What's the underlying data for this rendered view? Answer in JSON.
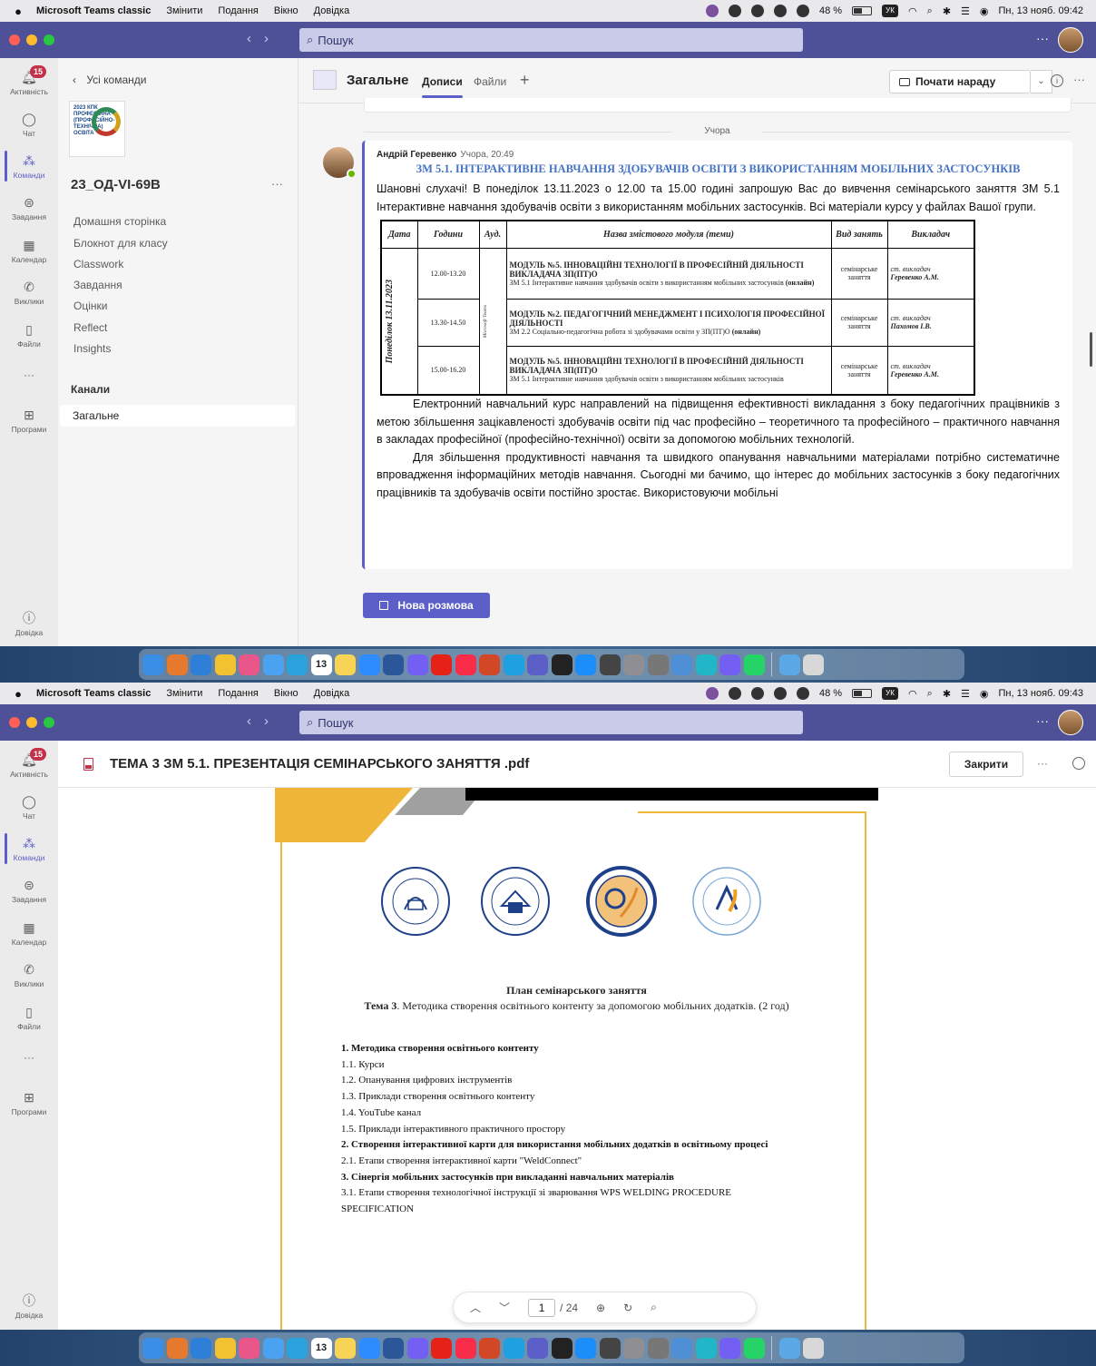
{
  "menubar": {
    "apple": "",
    "app": "Microsoft Teams classic",
    "items": [
      "Змінити",
      "Подання",
      "Вікно",
      "Довідка"
    ],
    "battery": "48 %",
    "keyboard": "УК",
    "datetime_1": "Пн, 13 нояб. 09:42",
    "datetime_2": "Пн, 13 нояб. 09:43"
  },
  "titlebar": {
    "search_placeholder": "Пошук",
    "more": "···"
  },
  "rail": {
    "activity": "Активність",
    "activity_badge": "15",
    "chat": "Чат",
    "teams": "Команди",
    "assignments": "Завдання",
    "calendar": "Календар",
    "calls": "Виклики",
    "files": "Файли",
    "more": "···",
    "apps": "Програми",
    "help": "Довідка"
  },
  "team": {
    "back": "Усі команди",
    "logo_text": "2023 КПК ПРОФЕСІЙНА (ПРОФЕСІЙНО-ТЕХНІЧНА) ОСВІТА",
    "name": "23_ОД-VI-69В",
    "menu": "···",
    "links": [
      "Домашня сторінка",
      "Блокнот для класу",
      "Classwork",
      "Завдання",
      "Оцінки",
      "Reflect",
      "Insights"
    ],
    "channels_header": "Канали",
    "channel": "Загальне"
  },
  "channel": {
    "name": "Загальне",
    "tabs": [
      "Дописи",
      "Файли"
    ],
    "plus": "+",
    "meet": "Почати нараду",
    "date_separator": "Учора",
    "new_conversation": "Нова розмова"
  },
  "post": {
    "author": "Андрій Геревенко",
    "time": "Учора, 20:49",
    "title": "ЗМ 5.1. ІНТЕРАКТИВНЕ НАВЧАННЯ ЗДОБУВАЧІВ ОСВІТИ З ВИКОРИСТАННЯМ МОБІЛЬНИХ ЗАСТОСУНКІВ",
    "greeting": "Шановні слухачі! В понеділок 13.11.2023 о 12.00 та 15.00 годині запрошую Вас до вивчення семінарського заняття ЗМ 5.1 Інтерактивне навчання здобувачів освіти з використанням мобільних застосунків. Всі матеріали курсу у файлах Вашої групи.",
    "para1": "Електронний навчальний курс направлений на підвищення ефективності викладання з боку педагогічних працівників з метою збільшення зацікавленості здобувачів освіти під час професійно – теоретичного та професійного – практичного навчання в закладах професійної (професійно-технічної) освіти за допомогою мобільних технологій.",
    "para2": "Для збільшення продуктивності навчання та швидкого опанування  навчальними матеріалами потрібно систематичне впровадження інформаційних методів навчання. Сьогодні ми бачимо, що інтерес до мобільних застосунків з боку педагогічних працівників та здобувачів освіти постійно зростає. Використовуючи мобільні",
    "table": {
      "headers": [
        "Дата",
        "Години",
        "Ауд.",
        "Назва змістового модуля (теми)",
        "Вид занять",
        "Викладач"
      ],
      "date": "Понеділок 13.11.2023",
      "room": "Microsoft Teams",
      "rows": [
        {
          "time": "12.00-13.20",
          "module": "МОДУЛЬ №5. ІННОВАЦІЙНІ ТЕХНОЛОГІЇ В ПРОФЕСІЙНІЙ ДІЯЛЬНОСТІ ВИКЛАДАЧА ЗП(ПТ)О",
          "topic": "ЗМ 5.1 Інтерактивне навчання здобувачів освіти з використанням мобільних застосунків",
          "mode": "(онлайн)",
          "kind": "семінарське заняття",
          "teacher_role": "ст. викладач",
          "teacher": "Геревенко А.М."
        },
        {
          "time": "13.30-14.50",
          "module": "МОДУЛЬ №2. ПЕДАГОГІЧНИЙ МЕНЕДЖМЕНТ І ПСИХОЛОГІЯ ПРОФЕСІЙНОЇ ДІЯЛЬНОСТІ",
          "topic": "ЗМ 2.2 Соціально-педагогічна робота зі здобувачами освіти у ЗП(ПТ)О",
          "mode": "(онлайн)",
          "kind": "семінарське заняття",
          "teacher_role": "ст. викладач",
          "teacher": "Пахомов І.В."
        },
        {
          "time": "15.00-16.20",
          "module": "МОДУЛЬ №5. ІННОВАЦІЙНІ ТЕХНОЛОГІЇ В ПРОФЕСІЙНІЙ ДІЯЛЬНОСТІ ВИКЛАДАЧА ЗП(ПТ)О",
          "topic": "ЗМ 5.1 Інтерактивне навчання здобувачів освіти з використанням мобільних застосунків",
          "mode": "",
          "kind": "семінарське заняття",
          "teacher_role": "ст. викладач",
          "teacher": "Геревенко А.М."
        }
      ]
    }
  },
  "document": {
    "title": "ТЕМА 3 ЗМ 5.1. ПРЕЗЕНТАЦІЯ СЕМІНАРСЬКОГО ЗАНЯТТЯ .pdf",
    "close": "Закрити",
    "more": "···",
    "seal_texts": [
      "НАЦІОНАЛЬНА АКАДЕМІЯ ПЕДАГОГІЧНИХ НАУК УКРАЇНИ",
      "УНІВЕРСИТЕТ МЕНЕДЖМЕНТУ ОСВІТИ",
      "БІНПО",
      "БІНПО"
    ],
    "plan_title": "План семінарського заняття",
    "theme_label": "Тема 3",
    "theme_text": ". Методика створення освітнього контенту за допомогою мобільних додатків. (2 год)",
    "plan_items": [
      {
        "text": "1. Методика створення освітнього контенту",
        "bold": true
      },
      {
        "text": "1.1. Курси",
        "bold": false
      },
      {
        "text": "1.2. Опанування цифрових інструментів",
        "bold": false
      },
      {
        "text": "1.3. Приклади створення освітнього контенту",
        "bold": false
      },
      {
        "text": "1.4. YouTube канал",
        "bold": false
      },
      {
        "text": "1.5. Приклади інтерактивного практичного простору",
        "bold": false
      },
      {
        "text": "2. Створення інтерактивної карти для використання мобільних додатків в освітньому процесі",
        "bold": true
      },
      {
        "text": "2.1. Етапи створення інтерактивної карти \"WeldConnect\"",
        "bold": false
      },
      {
        "text": "3. Сінергія мобільних застосунків при викладанні навчальних матеріалів",
        "bold": true
      },
      {
        "text": "3.1. Етапи створення технологічної інструкції зі зварювання WPS WELDING PROCEDURE SPECIFICATION",
        "bold": false
      }
    ],
    "page_current": "1",
    "page_total": "/ 24"
  },
  "dock": {
    "calendar_day": "13",
    "apps": [
      "Finder",
      "Launchpad",
      "Safari",
      "Chrome",
      "Photos",
      "Mail",
      "Telegram",
      "Calendar",
      "Notes",
      "Zoom",
      "Word",
      "Viber",
      "YouTube",
      "Music",
      "Powerpoint",
      "Sky",
      "Teams",
      "ChatGPT",
      "App Store",
      "Calculator",
      "Settings",
      "Printer",
      "Preview",
      "Canva",
      "Viber2",
      "WhatsApp",
      "Downloads",
      "Trash"
    ]
  },
  "colors": {
    "teams_purple": "#5b5fc7",
    "titlebar": "#4e5198",
    "badge_red": "#c4314b",
    "post_title_blue": "#4472c4",
    "presentation_orange": "#f0b63a"
  }
}
